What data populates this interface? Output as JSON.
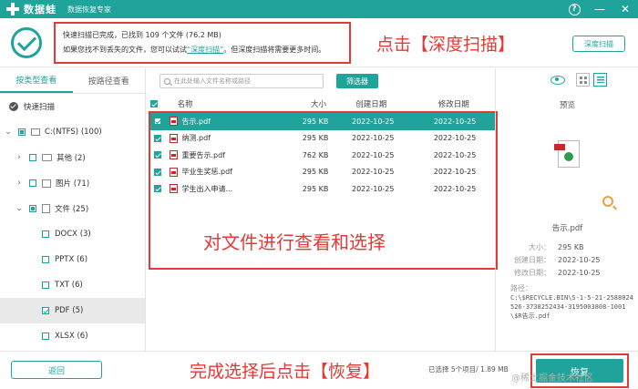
{
  "titlebar": {
    "app_name": "数据蛙",
    "subtitle": "数据恢复专家",
    "help_glyph": "?",
    "minimize_glyph": "—",
    "close_glyph": "✕"
  },
  "header": {
    "scan_line1": "快速扫描已完成，已找到 109 个文件 (76.2 MB)",
    "scan_line2_pre": "如果您找不到丢失的文件，您可以试试",
    "scan_line2_link": "“深度扫描”",
    "scan_line2_post": "。但深度扫描将需要更多时间。",
    "deep_scan_button": "深度扫描"
  },
  "annotations": {
    "top": "点击【深度扫描】",
    "middle": "对文件进行查看和选择",
    "bottom": "完成选择后点击【恢复】",
    "color": "#e53935"
  },
  "left_panel": {
    "tabs": [
      "按类型查看",
      "按路径查看"
    ],
    "quick_scan": "快速扫描",
    "drive": "C:(NTFS) (100)",
    "other": "其他 (2)",
    "images": "图片 (71)",
    "documents": "文件 (25)",
    "doc_types": [
      {
        "label": "DOCX (3)",
        "checked": false
      },
      {
        "label": "PPTX (6)",
        "checked": false
      },
      {
        "label": "TXT (6)",
        "checked": false
      },
      {
        "label": "PDF (5)",
        "checked": true
      },
      {
        "label": "XLSX (6)",
        "checked": false
      }
    ],
    "tree_arrow": "›",
    "tree_arrow_open": "⌄"
  },
  "toolbar": {
    "search_placeholder": "在此处输入文件名称或路径",
    "filter_button": "筛选器"
  },
  "table": {
    "headers": {
      "name": "名称",
      "size": "大小",
      "created": "创建日期",
      "modified": "修改日期"
    },
    "rows": [
      {
        "name": "告示.pdf",
        "size": "295 KB",
        "created": "2022-10-25",
        "modified": "2022-10-25"
      },
      {
        "name": "纳测.pdf",
        "size": "295 KB",
        "created": "2022-10-25",
        "modified": "2022-10-25"
      },
      {
        "name": "重要告示.pdf",
        "size": "762 KB",
        "created": "2022-10-25",
        "modified": "2022-10-25"
      },
      {
        "name": "毕业生奖惩.pdf",
        "size": "295 KB",
        "created": "2022-10-25",
        "modified": "2022-10-25"
      },
      {
        "name": "学生出入申请...",
        "size": "295 KB",
        "created": "2022-10-25",
        "modified": "2022-10-25"
      }
    ]
  },
  "preview": {
    "title": "预览",
    "file_name": "告示.pdf",
    "size_label": "大小：",
    "size_value": "295 KB",
    "created_label": "创建日期：",
    "created_value": "2022-10-25",
    "modified_label": "修改日期：",
    "modified_value": "2022-10-25",
    "path_label": "路径：",
    "path_value": "C:\\$RECYCLE.BIN\\S-1-5-21-2588024526-3738252434-3195003808-1001\\$R告示.pdf"
  },
  "bottom": {
    "back_button": "返回",
    "selection_status": "已选择 5个项目/ 1.89 MB",
    "recover_button": "恢复",
    "watermark": "@稀土掘金技术社区"
  }
}
